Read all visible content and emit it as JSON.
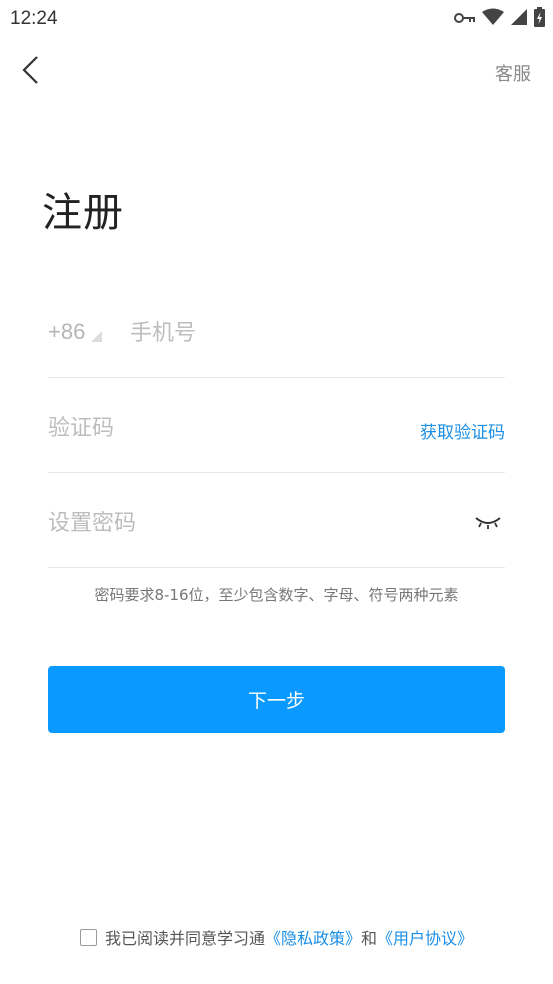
{
  "status_bar": {
    "time": "12:24",
    "icons": [
      "key-icon",
      "wifi-icon",
      "cell-signal-icon",
      "battery-charging-icon"
    ]
  },
  "nav": {
    "back_icon": "chevron-left-icon",
    "service_label": "客服"
  },
  "page": {
    "title": "注册"
  },
  "form": {
    "country_code": "+86",
    "phone_placeholder": "手机号",
    "code_placeholder": "验证码",
    "get_code_label": "获取验证码",
    "password_placeholder": "设置密码",
    "password_toggle_icon": "eye-closed-icon",
    "password_hint": "密码要求8-16位，至少包含数字、字母、符号两种元素",
    "next_label": "下一步"
  },
  "agreement": {
    "prefix": "我已阅读并同意学习通",
    "privacy_link": "《隐私政策》",
    "and": "和",
    "terms_link": "《用户协议》",
    "checked": false
  },
  "colors": {
    "accent": "#0a99ff",
    "link": "#1a8ee6",
    "placeholder": "#bdbdbd",
    "divider": "#e8e8e8"
  }
}
